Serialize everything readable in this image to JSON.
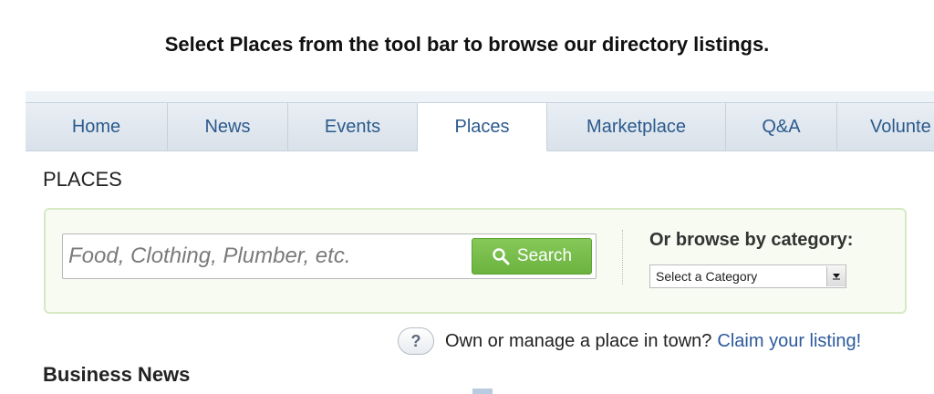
{
  "caption": "Select Places from the tool bar to browse our directory listings.",
  "tabs": [
    {
      "label": "Home",
      "active": false
    },
    {
      "label": "News",
      "active": false
    },
    {
      "label": "Events",
      "active": false
    },
    {
      "label": "Places",
      "active": true
    },
    {
      "label": "Marketplace",
      "active": false
    },
    {
      "label": "Q&A",
      "active": false
    },
    {
      "label": "Volunte",
      "active": false
    }
  ],
  "places": {
    "heading": "PLACES",
    "search": {
      "placeholder": "Food, Clothing, Plumber, etc.",
      "button_label": "Search",
      "button_icon": "magnifier-icon"
    },
    "browse": {
      "label": "Or browse by category:",
      "selected": "Select a Category"
    }
  },
  "help": {
    "icon": "question-bubble-icon",
    "icon_glyph": "?",
    "text": "Own or manage a place in town?",
    "link": "Claim your listing!"
  },
  "business_news": "Business News",
  "colors": {
    "tab_text": "#2b5a8c",
    "search_button": "#6bb33e",
    "search_panel_bg": "#f7fbf2",
    "link": "#2b5a9c"
  }
}
